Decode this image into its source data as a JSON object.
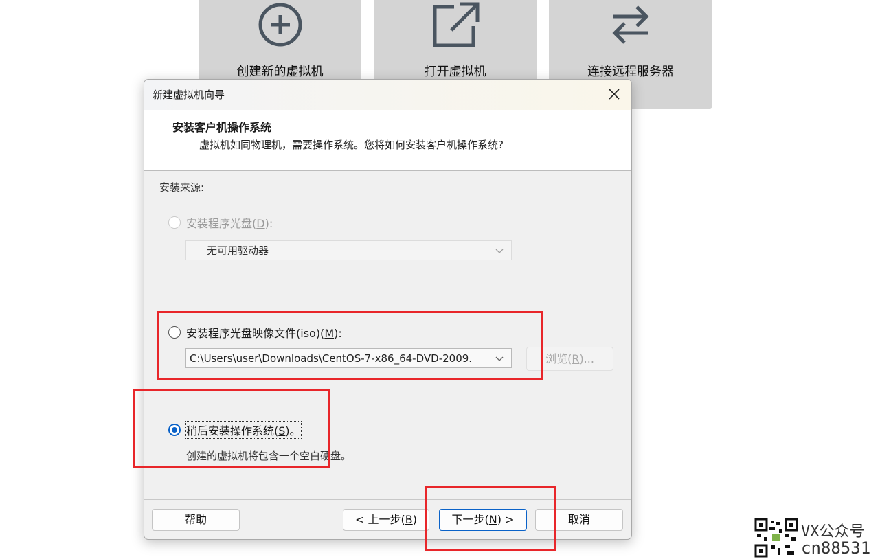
{
  "home_tiles": [
    {
      "label": "创建新的虚拟机",
      "icon": "plus-circle-icon"
    },
    {
      "label": "打开虚拟机",
      "icon": "open-external-icon"
    },
    {
      "label": "连接远程服务器",
      "icon": "swap-arrows-icon"
    }
  ],
  "dialog": {
    "title": "新建虚拟机向导",
    "header_title": "安装客户机操作系统",
    "header_subtitle": "虚拟机如同物理机，需要操作系统。您将如何安装客户机操作系统?",
    "section_label": "安装来源:",
    "options": {
      "disc": {
        "label": "安装程序光盘(",
        "key": "D",
        "suffix": "):",
        "selected": false,
        "enabled": false,
        "select_value": "无可用驱动器"
      },
      "iso": {
        "label": "安装程序光盘映像文件(iso)(",
        "key": "M",
        "suffix": "):",
        "selected": false,
        "enabled": true,
        "select_value": "C:\\Users\\user\\Downloads\\CentOS-7-x86_64-DVD-2009.",
        "browse_label": "浏览(",
        "browse_key": "R",
        "browse_suffix": ")..."
      },
      "later": {
        "label": "稍后安装操作系统(",
        "key": "S",
        "suffix": ")。",
        "selected": true,
        "enabled": true,
        "description": "创建的虚拟机将包含一个空白硬盘。"
      }
    },
    "buttons": {
      "help": "帮助",
      "back_prefix": "< 上一步(",
      "back_key": "B",
      "back_suffix": ")",
      "next_prefix": "下一步(",
      "next_key": "N",
      "next_suffix": ") >",
      "cancel": "取消"
    }
  },
  "watermark": {
    "line1": "VX公众号",
    "line2": "cn88531"
  },
  "colors": {
    "accent": "#0a62c8",
    "highlight_box": "#e8262a",
    "tile_bg": "#d4d4d4"
  }
}
